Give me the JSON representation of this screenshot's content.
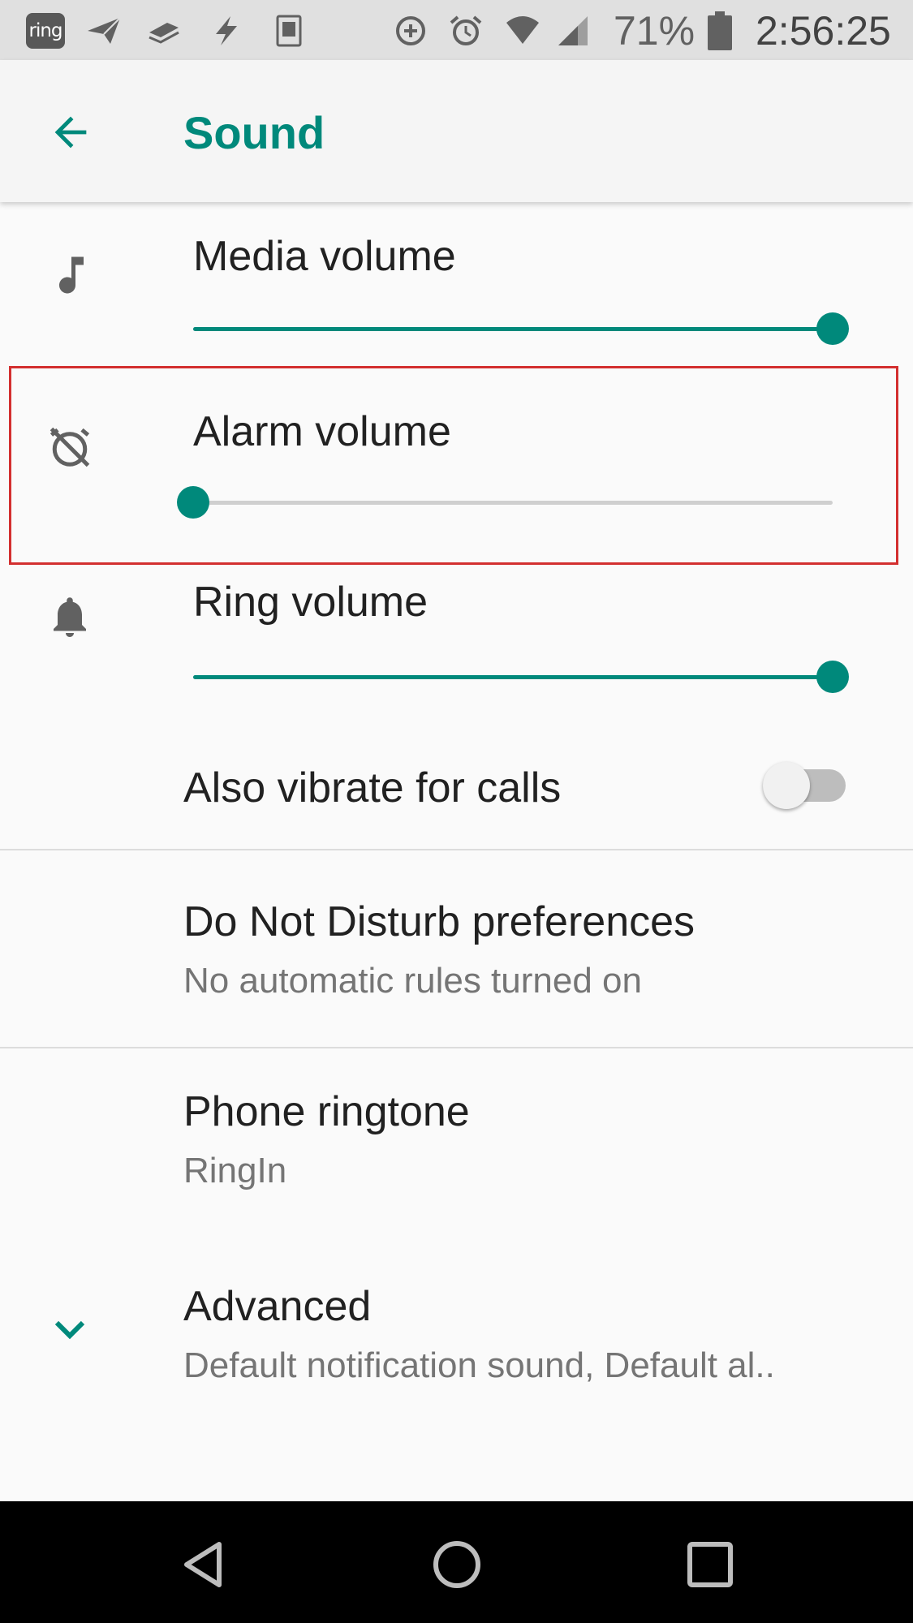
{
  "status_bar": {
    "ring_app": "ring",
    "battery": "71%",
    "time": "2:56:25",
    "icons": [
      "ring-app-icon",
      "send-icon",
      "layers-icon",
      "flash-icon",
      "kindle-icon",
      "data-saver-icon",
      "alarm-icon",
      "wifi-icon",
      "signal-icon",
      "battery-icon"
    ]
  },
  "toolbar": {
    "title": "Sound",
    "back_icon": "arrow-back-icon"
  },
  "volumes": [
    {
      "label": "Media volume",
      "icon": "music-note-icon",
      "level": 1.0
    },
    {
      "label": "Alarm volume",
      "icon": "alarm-off-icon",
      "level": 0.0
    },
    {
      "label": "Ring volume",
      "icon": "bell-icon",
      "level": 1.0
    }
  ],
  "vibrate": {
    "label": "Also vibrate for calls",
    "on": false
  },
  "dnd": {
    "title": "Do Not Disturb preferences",
    "summary": "No automatic rules turned on"
  },
  "ringtone": {
    "title": "Phone ringtone",
    "summary": "RingIn"
  },
  "advanced": {
    "title": "Advanced",
    "summary": "Default notification sound, Default al.."
  },
  "colors": {
    "accent": "#00897b",
    "highlight": "#d32f2f"
  },
  "nav": {
    "buttons": [
      "back-triangle-icon",
      "home-circle-icon",
      "recents-square-icon"
    ]
  }
}
